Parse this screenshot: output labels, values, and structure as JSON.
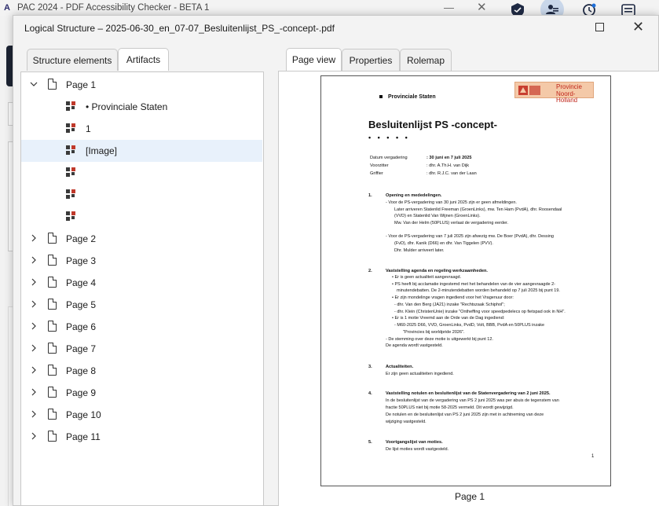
{
  "app": {
    "title": "PAC 2024 - PDF Accessibility Checker - BETA 1",
    "logo": "A",
    "minimize": "—",
    "close": "✕"
  },
  "dialog": {
    "title": "Logical Structure – 2025-06-30_en_07-07_Besluitenlijst_PS_-concept-.pdf",
    "left_tabs": [
      "Structure elements",
      "Artifacts"
    ],
    "right_tabs": [
      "Page view",
      "Properties",
      "Rolemap"
    ],
    "close": "✕"
  },
  "tree": {
    "page1": "Page 1",
    "artifacts": [
      "• Provinciale Staten",
      "1",
      "[Image]",
      "",
      "",
      ""
    ],
    "pages": [
      "Page 2",
      "Page 3",
      "Page 4",
      "Page 5",
      "Page 6",
      "Page 7",
      "Page 8",
      "Page 9",
      "Page 10",
      "Page 11"
    ]
  },
  "page_view": {
    "caption": "Page 1",
    "org": "Provinciale Staten",
    "logo_line1": "Provincie",
    "logo_line2": "Noord-Holland",
    "title": "Besluitenlijst PS -concept-",
    "dots": "• • • • •",
    "meta": [
      {
        "k": "Datum vergadering",
        "v": ": 30 juni en 7 juli 2025"
      },
      {
        "k": "Voorzitter",
        "v": ": dhr. A.Th.H. van Dijk"
      },
      {
        "k": "Griffier",
        "v": ": dhr. R.J.C. van der Laan"
      }
    ],
    "sections": [
      {
        "num": "1.",
        "head": "Opening en mededelingen."
      },
      {
        "num": "2.",
        "head": "Vaststelling agenda en regeling werkzaamheden."
      },
      {
        "num": "3.",
        "head": "Actualiteiten."
      },
      {
        "num": "4.",
        "head": "Vaststelling notulen en besluitenlijst van de Statenvergadering van 2 juni 2025."
      },
      {
        "num": "5.",
        "head": "Voortgangslijst van moties."
      }
    ],
    "lines": [
      "-    Voor de PS-vergadering van 30 juni 2025 zijn er geen afmeldingen.",
      "Later arriveren Statenlid Freeman (GroenLinks), mw. Ten Ham (PvdA), dhr. Roosendaal",
      "(VVD) en Statenlid Van Wijnen (GroenLinks).",
      "Mw. Van der Helm (50PLUS) verlaat de vergadering eerder.",
      "-    Voor de PS-vergadering van 7 juli 2025 zijn afwezig mw. De Boer (PvdA), dhr. Dessing",
      "(FvD), dhr. Kanik (D66) en dhr. Van Tiggelen (PVV).",
      "Dhr. Mulder arriveert later.",
      "•  Er is geen actualiteit aangevraagd.",
      "•  PS heeft bij acclamatie ingestemd met het behandelen van de vier aangevraagde 2-",
      "minutendebatten. De 2-minutendebatten worden behandeld op 7 juli 2025 bij punt 19.",
      "•  Er zijn mondelinge vragen ingediend voor het Vragenuur door:",
      "- dhr. Van den Berg (JA21) inzake \"Rechtszaak Schiphol\";",
      "- dhr. Klein (ChristenUnie) inzake \"Ontheffing voor speedpedelecs op fietspad ook in NH\".",
      "•  Er is 1 motie Vreemd aan de Orde van de Dag ingediend:",
      "-    M60-2025 D66, VVD, GroenLinks, PvdD, Volt, BBB, PvdA en 50PLUS inzake",
      "\"Provincies bij worldpride 2026\".",
      "-    De stemming over deze motie is uitgewerkt bij punt 12.",
      "De agenda wordt vastgesteld.",
      "Er zijn geen actualiteiten ingediend.",
      "In de besluitenlijst van de vergadering van PS 2 juni 2025 was per abuis de tegenstem van",
      "fractie 50PLUS niet bij motie 58-2025 vermeld. Dit wordt gewijzigd.",
      "De notulen en de besluitenlijst van PS 2 juni 2025 zijn met in achtneming van deze",
      "wijziging vastgesteld.",
      "De lijst moties wordt vastgesteld."
    ],
    "page_number": "1"
  },
  "colors": {
    "dialog_bg": "#f3f3f3",
    "selected_row": "#e8f1fb",
    "artifact_red": "#c0392b",
    "artifact_dark": "#3a3a3a"
  }
}
